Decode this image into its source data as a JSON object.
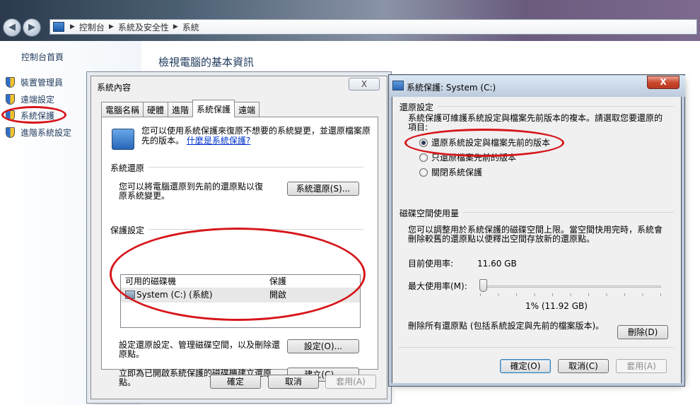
{
  "explorer": {
    "breadcrumb": [
      "控制台",
      "系統及安全性",
      "系統"
    ],
    "sidebar_home": "控制台首頁",
    "sidebar_items": [
      {
        "label": "裝置管理員",
        "icon": "shield-icon"
      },
      {
        "label": "遠端設定",
        "icon": "shield-icon"
      },
      {
        "label": "系統保護",
        "icon": "shield-icon"
      },
      {
        "label": "進階系統設定",
        "icon": "shield-icon"
      }
    ],
    "main_title": "檢視電腦的基本資訊"
  },
  "sys_props": {
    "title": "系統內容",
    "close_label": "X",
    "tabs": [
      "電腦名稱",
      "硬體",
      "進階",
      "系統保護",
      "遠端"
    ],
    "active_tab": "系統保護",
    "intro_text": "您可以使用系統保護來復原不想要的系統變更，並還原檔案原先的版本。",
    "intro_link": "什麼是系統保護?",
    "restore_group": "系統還原",
    "restore_text": "您可以將電腦還原到先前的還原點以復原系統變更。",
    "restore_button": "系統還原(S)...",
    "protect_group": "保護設定",
    "list_headers": [
      "可用的磁碟機",
      "保護"
    ],
    "list_rows": [
      {
        "drive": "System (C:) (系統)",
        "status": "開啟"
      }
    ],
    "config_text": "設定還原設定、管理磁碟空間，以及刪除還原點。",
    "config_button": "設定(O)...",
    "create_text": "立即為已開啟系統保護的磁碟機建立還原點。",
    "create_button": "建立(C)...",
    "ok": "確定",
    "cancel": "取消",
    "apply": "套用(A)"
  },
  "sys_protect": {
    "title": "系統保護: System (C:)",
    "close_label": "X",
    "restore_group": "還原設定",
    "restore_desc": "系統保護可維護系統設定與檔案先前版本的複本。請選取您要還原的項目:",
    "options": [
      {
        "label": "還原系統設定與檔案先前的版本",
        "selected": true
      },
      {
        "label": "只還原檔案先前的版本",
        "selected": false
      },
      {
        "label": "關閉系統保護",
        "selected": false
      }
    ],
    "disk_group": "磁碟空間使用量",
    "disk_desc": "您可以調整用於系統保護的磁碟空間上限。當空間快用完時，系統會刪除較舊的還原點以便釋出空間存放新的還原點。",
    "current_usage_label": "目前使用率:",
    "current_usage_value": "11.60 GB",
    "max_usage_label": "最大使用率(M):",
    "max_usage_value": "1% (11.92 GB)",
    "max_usage_fraction": 0.01,
    "delete_text": "刪除所有還原點 (包括系統設定與先前的檔案版本)。",
    "delete_button": "刪除(D)",
    "ok": "確定(O)",
    "cancel": "取消(C)",
    "apply": "套用(A)"
  },
  "colors": {
    "annotation": "#d6161b",
    "link": "#0033cc",
    "nav_text": "#1e395b"
  }
}
